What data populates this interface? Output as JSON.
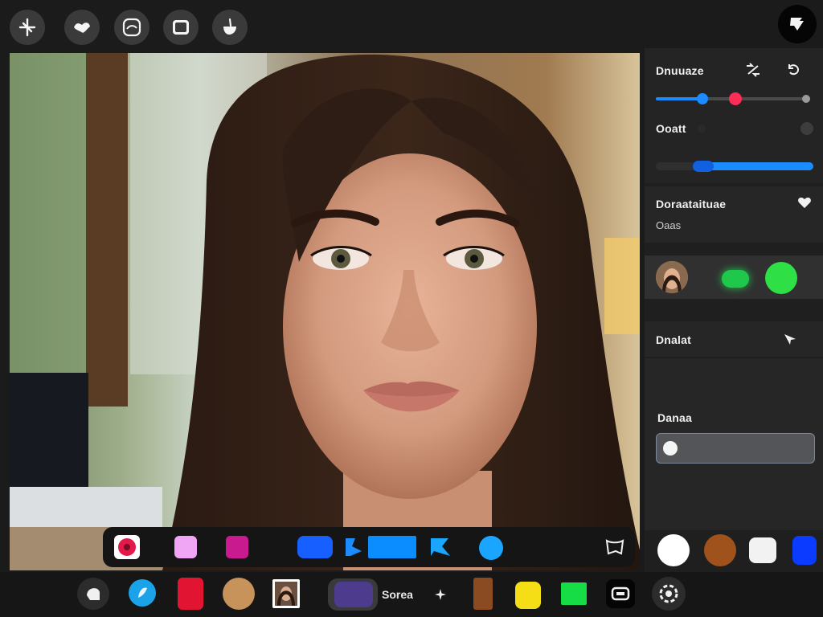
{
  "toolbar": {
    "tools": [
      {
        "name": "crop-tool",
        "icon": "crop-icon"
      },
      {
        "name": "heal-tool",
        "icon": "bandage-icon"
      },
      {
        "name": "frame-tool",
        "icon": "frame-icon"
      },
      {
        "name": "layers-tool",
        "icon": "layers-icon"
      },
      {
        "name": "brush-tool",
        "icon": "hand-brush-icon"
      }
    ],
    "export_icon": "export-icon"
  },
  "panel": {
    "adjust": {
      "title": "Dnuuaze",
      "slider1": {
        "value": 0.38,
        "secondary": 0.58
      },
      "label2": "Ooatt",
      "slider2": {
        "value": 0.27
      }
    },
    "presets": {
      "title": "Doraataituae",
      "subtitle": "Oaas"
    },
    "sample": {
      "colors": [
        "#1fc84a",
        "#2ee045"
      ]
    },
    "layers": {
      "title": "Dnalat"
    },
    "input": {
      "label": "Danaa"
    },
    "swatches": [
      "#ffffff",
      "#a0521c",
      "#f2f2f2",
      "#0b3bff"
    ]
  },
  "subtools": {
    "colors": [
      "#f0a6f5",
      "#c91a8f",
      "#1760ff",
      "#0b8cff",
      "#1aa6ff"
    ]
  },
  "bottombar": {
    "label": "Sorea",
    "colors": [
      "#1aa3e8",
      "#e11531",
      "#c8935b",
      "#4d3b8e",
      "#8a4a22",
      "#f5de16",
      "#16dc45"
    ]
  }
}
